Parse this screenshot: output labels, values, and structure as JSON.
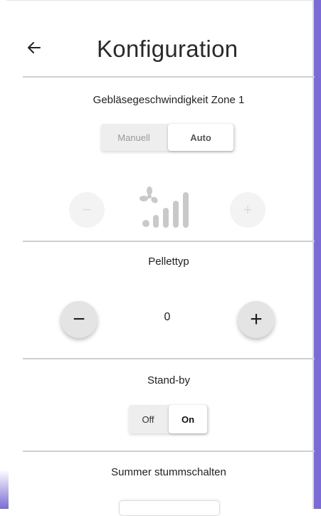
{
  "header": {
    "title": "Konfiguration",
    "back_icon": "arrow-left-icon"
  },
  "fan_speed": {
    "title": "Gebläsegeschwindigkeit Zone 1",
    "mode_options": [
      "Manuell",
      "Auto"
    ],
    "selected_mode": "Auto",
    "minus_label": "−",
    "plus_label": "+",
    "enabled": false,
    "icon": "fan-speed-icon"
  },
  "pellet_type": {
    "title": "Pellettyp",
    "value": "0",
    "minus_label": "−",
    "plus_label": "+"
  },
  "standby": {
    "title": "Stand-by",
    "options": [
      "Off",
      "On"
    ],
    "selected": "On"
  },
  "buzzer": {
    "title": "Summer stummschalten"
  },
  "colors": {
    "accent": "#7a6bd6",
    "divider": "#cfcfcf",
    "button": "#e4e4e4"
  }
}
